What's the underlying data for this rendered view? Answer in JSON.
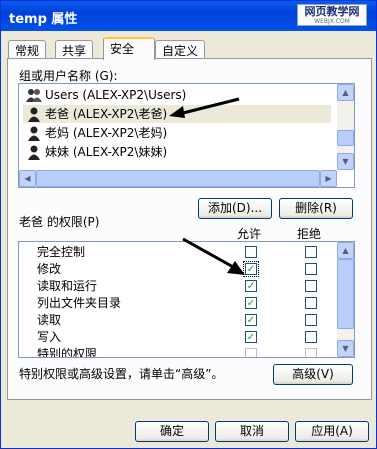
{
  "window": {
    "title": "temp 属性",
    "brand_top": "网页教学网",
    "brand_sub": "WEBJX.COM"
  },
  "tabs": [
    {
      "label": "常规"
    },
    {
      "label": "共享"
    },
    {
      "label": "安全"
    },
    {
      "label": "自定义"
    }
  ],
  "users": {
    "label": "组或用户名称 (G):",
    "items": [
      {
        "label": "Users (ALEX-XP2\\Users)"
      },
      {
        "label": "老爸 (ALEX-XP2\\老爸)",
        "selected": true
      },
      {
        "label": "老妈 (ALEX-XP2\\老妈)"
      },
      {
        "label": "妹妹 (ALEX-XP2\\妹妹)"
      }
    ]
  },
  "buttons": {
    "add": "添加(D)...",
    "remove": "删除(R)",
    "advanced": "高级(V)",
    "ok": "确定",
    "cancel": "取消",
    "apply": "应用(A)"
  },
  "permissions": {
    "label": "老爸 的权限(P)",
    "allow_header": "允许",
    "deny_header": "拒绝",
    "rows": [
      {
        "name": "完全控制",
        "allow": false,
        "deny": false
      },
      {
        "name": "修改",
        "allow": true,
        "deny": false
      },
      {
        "name": "读取和运行",
        "allow": true,
        "deny": false
      },
      {
        "name": "列出文件夹目录",
        "allow": true,
        "deny": false
      },
      {
        "name": "读取",
        "allow": true,
        "deny": false
      },
      {
        "name": "写入",
        "allow": true,
        "deny": false
      },
      {
        "name": "特别的权限",
        "allow": false,
        "deny": false
      }
    ]
  },
  "advanced_note": "特别权限或高级设置，请单击“高级”。",
  "colors": {
    "titlebar": "#0054E3",
    "panel": "#FCFCFE",
    "check": "#21A121",
    "arrow": "#000000"
  }
}
